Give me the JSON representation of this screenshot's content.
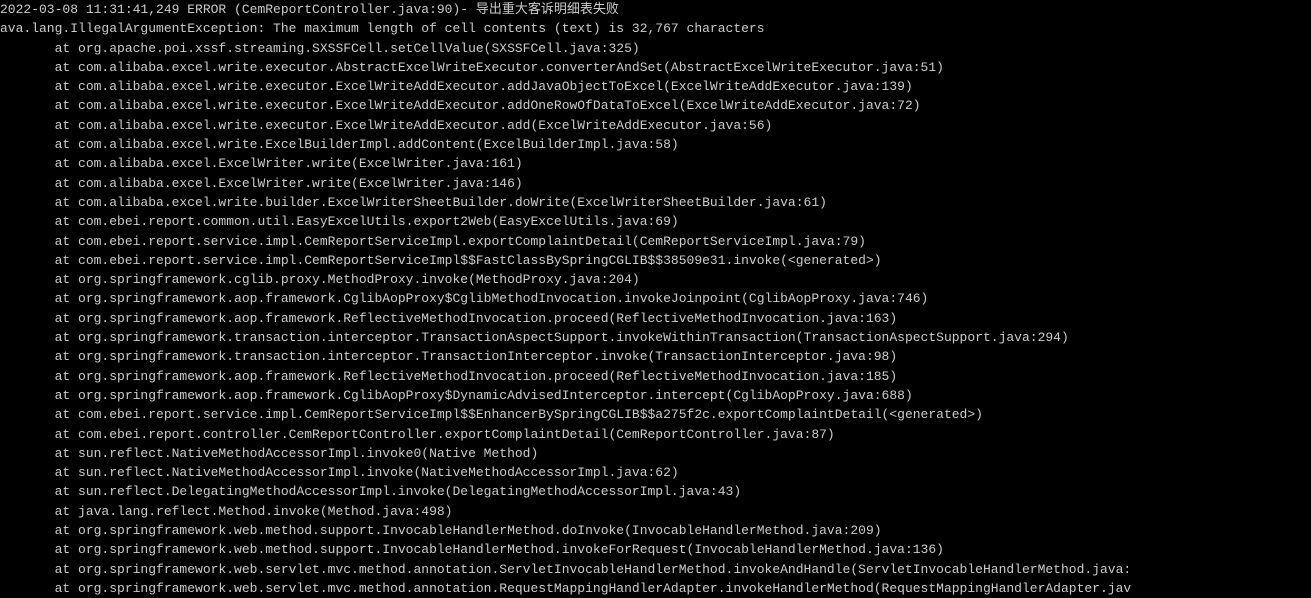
{
  "log": {
    "header": "2022-03-08 11:31:41,249 ERROR (CemReportController.java:90)- 导出重大客诉明细表失败",
    "exception": "ava.lang.IllegalArgumentException: The maximum length of cell contents (text) is 32,767 characters",
    "stack": [
      "       at org.apache.poi.xssf.streaming.SXSSFCell.setCellValue(SXSSFCell.java:325)",
      "       at com.alibaba.excel.write.executor.AbstractExcelWriteExecutor.converterAndSet(AbstractExcelWriteExecutor.java:51)",
      "       at com.alibaba.excel.write.executor.ExcelWriteAddExecutor.addJavaObjectToExcel(ExcelWriteAddExecutor.java:139)",
      "       at com.alibaba.excel.write.executor.ExcelWriteAddExecutor.addOneRowOfDataToExcel(ExcelWriteAddExecutor.java:72)",
      "       at com.alibaba.excel.write.executor.ExcelWriteAddExecutor.add(ExcelWriteAddExecutor.java:56)",
      "       at com.alibaba.excel.write.ExcelBuilderImpl.addContent(ExcelBuilderImpl.java:58)",
      "       at com.alibaba.excel.ExcelWriter.write(ExcelWriter.java:161)",
      "       at com.alibaba.excel.ExcelWriter.write(ExcelWriter.java:146)",
      "       at com.alibaba.excel.write.builder.ExcelWriterSheetBuilder.doWrite(ExcelWriterSheetBuilder.java:61)",
      "       at com.ebei.report.common.util.EasyExcelUtils.export2Web(EasyExcelUtils.java:69)",
      "       at com.ebei.report.service.impl.CemReportServiceImpl.exportComplaintDetail(CemReportServiceImpl.java:79)",
      "       at com.ebei.report.service.impl.CemReportServiceImpl$$FastClassBySpringCGLIB$$38509e31.invoke(<generated>)",
      "       at org.springframework.cglib.proxy.MethodProxy.invoke(MethodProxy.java:204)",
      "       at org.springframework.aop.framework.CglibAopProxy$CglibMethodInvocation.invokeJoinpoint(CglibAopProxy.java:746)",
      "       at org.springframework.aop.framework.ReflectiveMethodInvocation.proceed(ReflectiveMethodInvocation.java:163)",
      "       at org.springframework.transaction.interceptor.TransactionAspectSupport.invokeWithinTransaction(TransactionAspectSupport.java:294)",
      "       at org.springframework.transaction.interceptor.TransactionInterceptor.invoke(TransactionInterceptor.java:98)",
      "       at org.springframework.aop.framework.ReflectiveMethodInvocation.proceed(ReflectiveMethodInvocation.java:185)",
      "       at org.springframework.aop.framework.CglibAopProxy$DynamicAdvisedInterceptor.intercept(CglibAopProxy.java:688)",
      "       at com.ebei.report.service.impl.CemReportServiceImpl$$EnhancerBySpringCGLIB$$a275f2c.exportComplaintDetail(<generated>)",
      "       at com.ebei.report.controller.CemReportController.exportComplaintDetail(CemReportController.java:87)",
      "       at sun.reflect.NativeMethodAccessorImpl.invoke0(Native Method)",
      "       at sun.reflect.NativeMethodAccessorImpl.invoke(NativeMethodAccessorImpl.java:62)",
      "       at sun.reflect.DelegatingMethodAccessorImpl.invoke(DelegatingMethodAccessorImpl.java:43)",
      "       at java.lang.reflect.Method.invoke(Method.java:498)",
      "       at org.springframework.web.method.support.InvocableHandlerMethod.doInvoke(InvocableHandlerMethod.java:209)",
      "       at org.springframework.web.method.support.InvocableHandlerMethod.invokeForRequest(InvocableHandlerMethod.java:136)",
      "       at org.springframework.web.servlet.mvc.method.annotation.ServletInvocableHandlerMethod.invokeAndHandle(ServletInvocableHandlerMethod.java:",
      "       at org.springframework.web.servlet.mvc.method.annotation.RequestMappingHandlerAdapter.invokeHandlerMethod(RequestMappingHandlerAdapter.jav"
    ]
  }
}
